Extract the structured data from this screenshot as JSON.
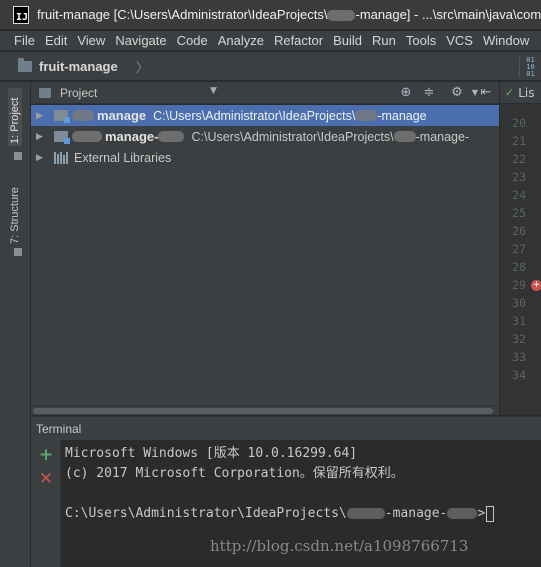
{
  "window": {
    "title_prefix": "fruit-manage [C:\\Users\\Administrator\\IdeaProjects\\",
    "title_suffix": "-manage] - ...\\src\\main\\java\\com"
  },
  "menu": [
    "File",
    "Edit",
    "View",
    "Navigate",
    "Code",
    "Analyze",
    "Refactor",
    "Build",
    "Run",
    "Tools",
    "VCS",
    "Window"
  ],
  "navbar": {
    "crumb": "fruit-manage"
  },
  "left_stripe": {
    "project_tab": "1: Project",
    "structure_tab": "7: Structure"
  },
  "project_panel": {
    "view_label": "Project",
    "tree": [
      {
        "name": "manage",
        "path": "C:\\Users\\Administrator\\IdeaProjects\\",
        "path_tail": "-manage",
        "selected": true
      },
      {
        "name": "manage-",
        "path": "C:\\Users\\Administrator\\IdeaProjects\\",
        "path_tail": "-manage-",
        "selected": false
      },
      {
        "name": "External Libraries"
      }
    ]
  },
  "editor": {
    "tab_label": "Lis",
    "line_numbers": [
      "20",
      "21",
      "22",
      "23",
      "24",
      "25",
      "26",
      "27",
      "28",
      "29",
      "30",
      "31",
      "32",
      "33",
      "34"
    ]
  },
  "terminal": {
    "header": "Terminal",
    "lines": [
      "Microsoft Windows [版本 10.0.16299.64]",
      "(c) 2017 Microsoft Corporation。保留所有权利。",
      "",
      "C:\\Users\\Administrator\\IdeaProjects\\"
    ],
    "prompt_tail": "-manage-",
    "prompt_end": ">"
  },
  "watermark": "http://blog.csdn.net/a1098766713",
  "icons": [
    "app-icon",
    "folder-icon",
    "module-icon",
    "library-icon",
    "target-icon",
    "collapse-icon",
    "gear-icon",
    "hide-icon",
    "add-icon",
    "close-icon",
    "breakpoint-icon"
  ],
  "colors": {
    "selection": "#4b6eaf",
    "add": "#59a869",
    "close": "#c75450"
  }
}
